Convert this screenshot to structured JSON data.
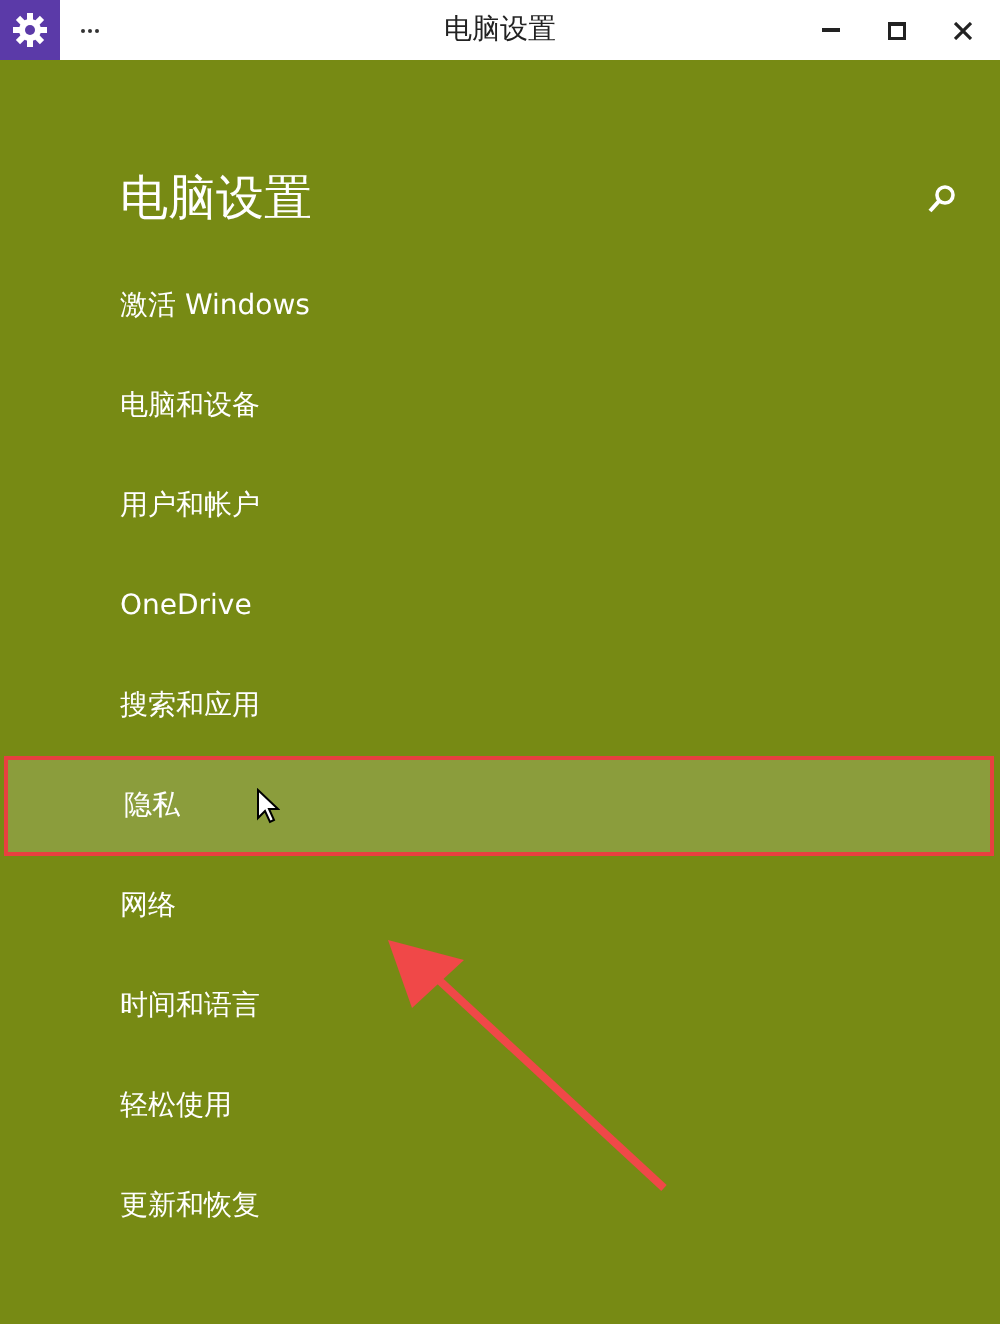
{
  "window": {
    "title": "电脑设置"
  },
  "heading": "电脑设置",
  "items": [
    {
      "label": "激活 Windows",
      "highlighted": false
    },
    {
      "label": "电脑和设备",
      "highlighted": false
    },
    {
      "label": "用户和帐户",
      "highlighted": false
    },
    {
      "label": "OneDrive",
      "highlighted": false
    },
    {
      "label": "搜索和应用",
      "highlighted": false
    },
    {
      "label": "隐私",
      "highlighted": true
    },
    {
      "label": "网络",
      "highlighted": false
    },
    {
      "label": "时间和语言",
      "highlighted": false
    },
    {
      "label": "轻松使用",
      "highlighted": false
    },
    {
      "label": "更新和恢复",
      "highlighted": false
    }
  ]
}
